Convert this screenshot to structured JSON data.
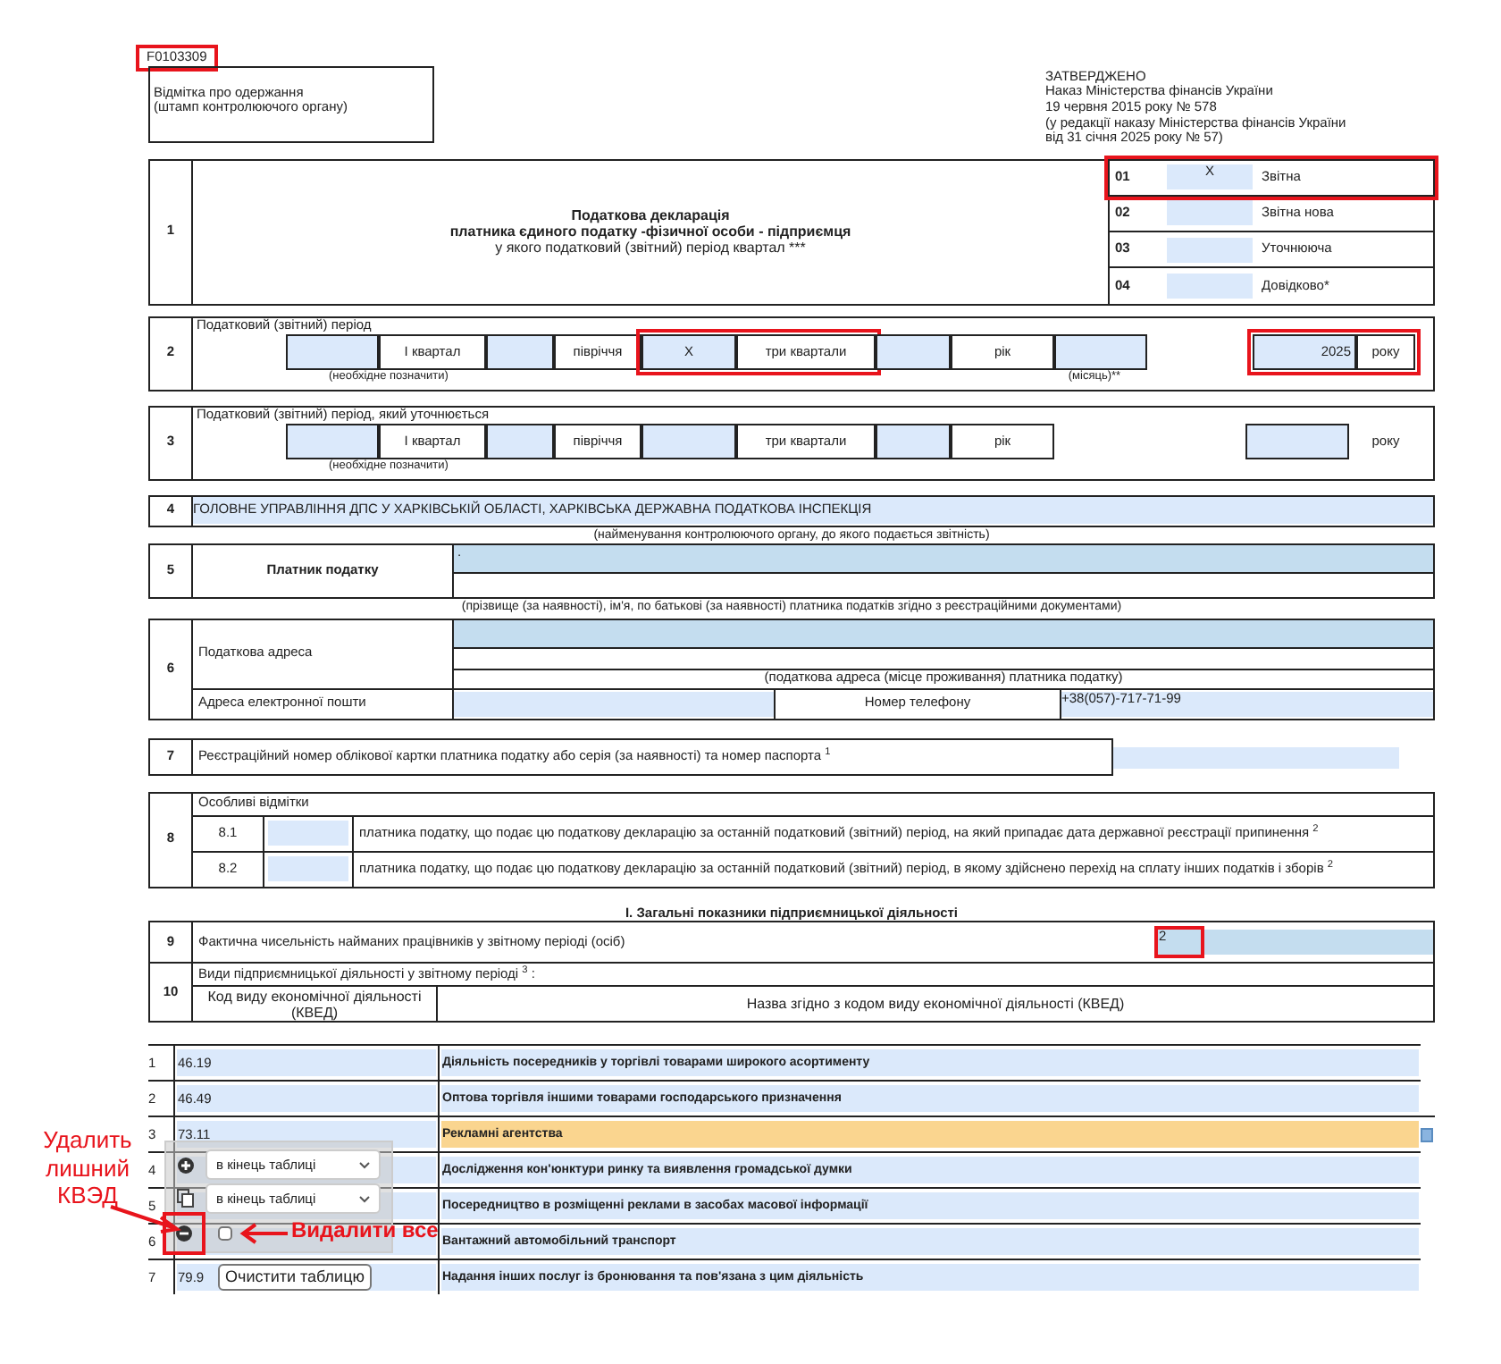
{
  "form_code": {
    "text": "F0103309",
    "highlighted": true
  },
  "stamp": [
    "Відмітка про одержання",
    "(штамп контролюючого органу)"
  ],
  "approval": [
    "ЗАТВЕРДЖЕНО",
    "Наказ Міністерства фінансів України",
    "19 червня 2015 року № 578",
    "(у редакції наказу Міністерства фінансів України",
    "від 31 січня 2025 року № 57)"
  ],
  "section1": {
    "number": "1",
    "title": [
      "Податкова декларація",
      "платника єдиного податку -фізичної особи - підприємця",
      "у якого податковий (звітний) період квартал ***"
    ],
    "types": [
      {
        "code": "01",
        "mark": "X",
        "label": "Звітна",
        "highlighted": true
      },
      {
        "code": "02",
        "label": "Звітна нова",
        "highlighted": false
      },
      {
        "code": "03",
        "label": "Уточнююча",
        "highlighted": false
      },
      {
        "code": "04",
        "label": "Довідково*",
        "highlighted": false
      }
    ]
  },
  "section2": {
    "number": "2",
    "label": "Податковий (звітний) період",
    "periods": [
      {
        "label": "I квартал",
        "highlighted": false
      },
      {
        "label": "півріччя",
        "highlighted": false
      },
      {
        "mark": "X",
        "label": "три квартали",
        "highlighted": true
      },
      {
        "label": "рік",
        "highlighted": false
      }
    ],
    "note": "(необхідне позначити)",
    "month_note": "(місяць)**",
    "year": "2025",
    "year_label": "року",
    "year_highlighted": true
  },
  "section3": {
    "number": "3",
    "label": "Податковий (звітний) період, який уточнюється",
    "periods": [
      {
        "label": "I квартал",
        "highlighted": false
      },
      {
        "label": "півріччя",
        "highlighted": false
      },
      {
        "label": "три квартали",
        "highlighted": false
      },
      {
        "label": "рік",
        "highlighted": false
      }
    ],
    "note": "(необхідне позначити)",
    "year_label": "року"
  },
  "section4": {
    "number": "4",
    "value": "ГОЛОВНЕ УПРАВЛІННЯ ДПС У ХАРКІВСЬКІЙ ОБЛАСТІ, ХАРКІВСЬКА ДЕРЖАВНА ПОДАТКОВА ІНСПЕКЦІЯ",
    "caption": "(найменування контролюючого органу, до якого подається звітність)"
  },
  "section5": {
    "number": "5",
    "label": "Платник податку",
    "value": ".",
    "caption": "(прізвище (за наявності), ім'я, по батькові (за наявності) платника податків згідно з реєстраційними документами)"
  },
  "section6": {
    "number": "6",
    "label": "Податкова адреса",
    "caption": "(податкова адреса (місце проживання) платника податку)",
    "email_label": "Адреса електронної пошти",
    "phone_label": "Номер телефону",
    "phone": "+38(057)-717-71-99"
  },
  "section7": {
    "number": "7",
    "label": "Реєстраційний номер облікової картки платника податку або серія (за наявності) та номер паспорта $^{1}$"
  },
  "section8": {
    "number": "8",
    "heading": "Особливі відмітки",
    "items": [
      {
        "code": "8.1",
        "text": "платника податку, що подає цю податкову декларацію за останній податковий (звітний) період, на який припадає дата державної реєстрації припинення $^{2}$"
      },
      {
        "code": "8.2",
        "text": "платника податку, що подає цю податкову декларацію за останній податковий (звітний) період, в якому здійснено перехід на сплату інших податків і зборів $^{2}$"
      }
    ]
  },
  "part_title": "I. Загальні показники підприємницької діяльності",
  "row9": {
    "number": "9",
    "label": "Фактична чисельність найманих працівників у звітному періоді (осіб)",
    "value": "2",
    "highlighted": true
  },
  "row10": {
    "number": "10",
    "label": "Види підприємницької діяльності у звітному періоді $^{3}$ :",
    "columns": [
      "Код виду економічної діяльності (КВЕД)",
      "Назва згідно з кодом виду економічної діяльності (КВЕД)"
    ]
  },
  "kved_rows": [
    {
      "number": "1",
      "code": "46.19",
      "name": "Діяльність посередників у торгівлі товарами широкого асортименту",
      "selected": false
    },
    {
      "number": "2",
      "code": "46.49",
      "name": "Оптова торгівля іншими товарами господарського призначення",
      "selected": false
    },
    {
      "number": "3",
      "code": "73.11",
      "name": "Рекламні агентства",
      "selected": true
    },
    {
      "number": "4",
      "name": "Дослідження кон'юнктури ринку та виявлення громадської думки",
      "selected": false
    },
    {
      "number": "5",
      "name": "Посередництво в розміщенні реклами в засобах масової інформації",
      "selected": false
    },
    {
      "number": "6",
      "name": "Вантажний автомобільний транспорт",
      "selected": false
    },
    {
      "number": "7",
      "code": "79.9",
      "name": "Надання інших послуг із бронювання та пов'язана з цим діяльність",
      "selected": false
    }
  ],
  "row_toolbar": {
    "add_position": "в кінець таблиці",
    "copy_position": "в кінець таблиці",
    "remove_highlighted": true,
    "clear_all_checked": false,
    "tooltip": "Очистити таблицю"
  },
  "annotations": [
    {
      "text": "Удалить лишний КВЭД"
    },
    {
      "text": "Видалити все"
    }
  ]
}
